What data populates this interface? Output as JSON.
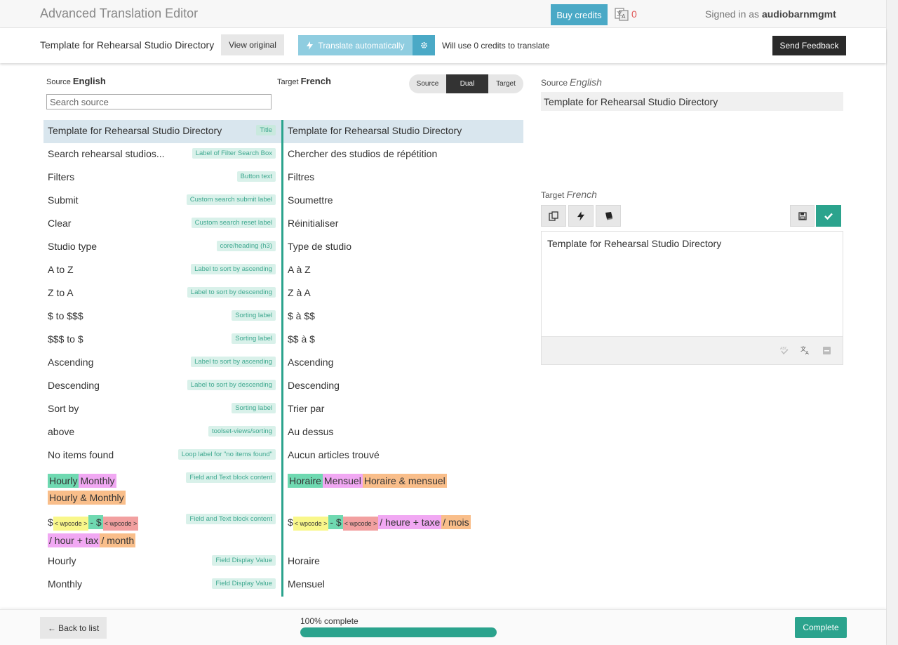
{
  "app": {
    "title": "Advanced Translation Editor"
  },
  "topbar": {
    "buy_credits": "Buy credits",
    "credit_count": "0",
    "signed_in_prefix": "Signed in as",
    "username": "audiobarnmgmt",
    "credit_icon": "translate-credits-icon"
  },
  "jobbar": {
    "job_title": "Template for Rehearsal Studio Directory",
    "view_original": "View original",
    "translate_auto": "Translate automatically",
    "credits_note": "Will use 0 credits to translate",
    "send_feedback": "Send Feedback"
  },
  "left": {
    "source_label": "Source",
    "source_lang": "English",
    "target_label": "Target",
    "target_lang": "French",
    "search_placeholder": "Search source",
    "view_modes": [
      "Source",
      "Dual",
      "Target"
    ],
    "active_view_mode": "Dual"
  },
  "segments": [
    {
      "source": "Template for Rehearsal Studio Directory",
      "tag": "Title",
      "target": "Template for Rehearsal Studio Directory",
      "selected": true
    },
    {
      "source": "Search rehearsal studios...",
      "tag": "Label of Filter Search Box",
      "target": "Chercher des studios de répétition"
    },
    {
      "source": "Filters",
      "tag": "Button text",
      "target": "Filtres"
    },
    {
      "source": "Submit",
      "tag": "Custom search submit label",
      "target": "Soumettre"
    },
    {
      "source": "Clear",
      "tag": "Custom search reset label",
      "target": "Réinitialiser"
    },
    {
      "source": "Studio type",
      "tag": "core/heading (h3)",
      "target": "Type de studio"
    },
    {
      "source": "A to Z",
      "tag": "Label to sort by ascending",
      "target": "A à Z"
    },
    {
      "source": "Z to A",
      "tag": "Label to sort by descending",
      "target": "Z à A"
    },
    {
      "source": "$ to $$$",
      "tag": "Sorting label",
      "target": "$ à $$"
    },
    {
      "source": "$$$ to $",
      "tag": "Sorting label",
      "target": "$$ à $"
    },
    {
      "source": "Ascending",
      "tag": "Label to sort by ascending",
      "target": "Ascending"
    },
    {
      "source": "Descending",
      "tag": "Label to sort by descending",
      "target": "Descending"
    },
    {
      "source": "Sort by",
      "tag": "Sorting label",
      "target": "Trier par"
    },
    {
      "source": "above",
      "tag": "toolset-views/sorting",
      "target": "Au dessus"
    },
    {
      "source": "No items found",
      "tag": "Loop label for \"no items found\"",
      "target": "Aucun articles trouvé"
    }
  ],
  "rich_segments": {
    "hourly_monthly": {
      "tag": "Field and Text block content",
      "source": [
        "Hourly",
        "Monthly",
        "Hourly & Monthly"
      ],
      "target": [
        "Horaire",
        "Mensuel",
        "Horaire & mensuel"
      ]
    },
    "price": {
      "tag": "Field and Text block content",
      "source": {
        "dollar": "$",
        "wpcode": "< wpcode >",
        "dash": "- $",
        "hour_tax": "/ hour + tax",
        "month": "/ month"
      },
      "target": {
        "dollar": "$",
        "wpcode": "< wpcode >",
        "dash": "- $",
        "hour_tax": "/ heure + taxe",
        "month": "/ mois"
      }
    }
  },
  "tail_segments": [
    {
      "source": "Hourly",
      "tag": "Field Display Value",
      "target": "Horaire"
    },
    {
      "source": "Monthly",
      "tag": "Field Display Value",
      "target": "Mensuel"
    }
  ],
  "right": {
    "source_label": "Source",
    "source_lang": "English",
    "source_text": "Template for Rehearsal Studio Directory",
    "target_label": "Target",
    "target_lang": "French",
    "editor_text": "Template for Rehearsal Studio Directory",
    "tool_icons": [
      "copy-source-icon",
      "machine-translate-icon",
      "glossary-icon",
      "save-icon",
      "confirm-icon"
    ],
    "footer_icons": [
      "spellcheck-icon",
      "translate-memory-icon",
      "comment-icon"
    ]
  },
  "footer": {
    "back": "← Back to list",
    "progress_text": "100% complete",
    "progress_value": 1.0,
    "complete": "Complete"
  },
  "colors": {
    "accent_teal": "#2ba38d",
    "buy_blue": "#4aa9c6",
    "auto_light_blue": "#8fcde0",
    "selected_row": "#d9e6ee"
  }
}
